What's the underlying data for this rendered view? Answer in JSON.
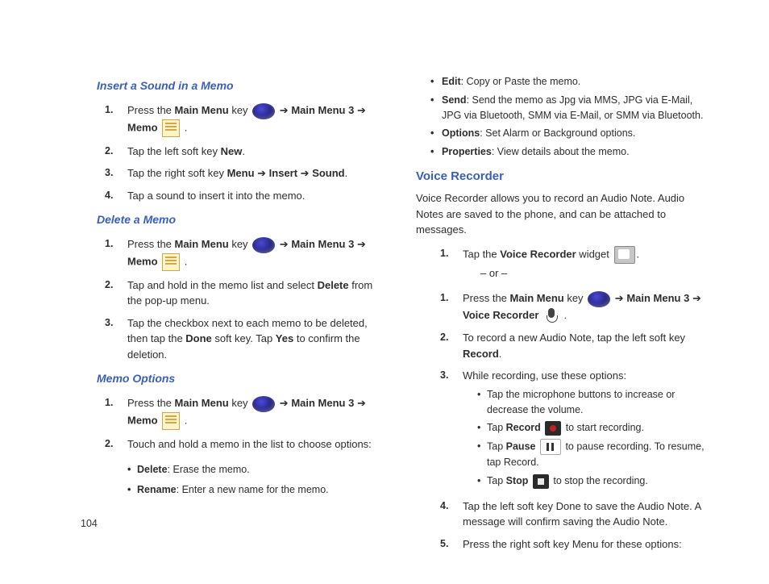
{
  "pageNumber": "104",
  "sec1": {
    "title": "Insert a Sound in a Memo",
    "s1a": "Press the ",
    "s1b": "Main Menu",
    "s1c": " key ",
    "s1d": " ➔ ",
    "s1e": "Main Menu 3",
    "s1f": " ➔ ",
    "s1g": "Memo",
    "s1h": " .",
    "s2a": "Tap the left soft key ",
    "s2b": "New",
    "s2c": ".",
    "s3a": "Tap the right soft key ",
    "s3b": "Menu",
    "s3c": " ➔ ",
    "s3d": "Insert",
    "s3e": " ➔ ",
    "s3f": "Sound",
    "s3g": ".",
    "s4": "Tap a sound to insert it into the memo."
  },
  "sec2": {
    "title": "Delete a Memo",
    "s1a": "Press the ",
    "s1b": "Main Menu",
    "s1c": " key ",
    "s1d": " ➔ ",
    "s1e": "Main Menu 3",
    "s1f": " ➔ ",
    "s1g": "Memo",
    "s1h": " .",
    "s2a": "Tap and hold in the memo list and select ",
    "s2b": "Delete",
    "s2c": " from the pop-up menu.",
    "s3a": "Tap the checkbox next to each memo to be deleted, then tap the ",
    "s3b": "Done",
    "s3c": " soft key.  Tap ",
    "s3d": "Yes",
    "s3e": " to confirm the deletion."
  },
  "sec3": {
    "title": "Memo Options",
    "s1a": "Press the ",
    "s1b": "Main Menu",
    "s1c": " key ",
    "s1d": " ➔ ",
    "s1e": "Main Menu 3",
    "s1f": " ➔ ",
    "s1g": "Memo",
    "s1h": " .",
    "s2": "Touch and hold a memo in the list to choose options:",
    "b1a": "Delete",
    "b1b": ": Erase the memo.",
    "b2a": "Rename",
    "b2b": ": Enter a new name for the memo."
  },
  "right": {
    "b1a": "Edit",
    "b1b": ": Copy or Paste the memo.",
    "b2a": "Send",
    "b2b": ": Send the memo as Jpg via MMS, JPG via E-Mail, JPG via Bluetooth, SMM via E-Mail, or SMM via Bluetooth.",
    "b3a": "Options",
    "b3b": ": Set Alarm or Background options.",
    "b4a": "Properties",
    "b4b": ": View details about the memo."
  },
  "sec4": {
    "title": "Voice Recorder",
    "intro": "Voice Recorder allows you to record an Audio Note.  Audio Notes are saved to the phone, and can be attached to messages.",
    "s1a": "Tap the ",
    "s1b": "Voice Recorder",
    "s1c": " widget ",
    "or": "– or –",
    "s1d": "Press the ",
    "s1e": "Main Menu",
    "s1f": " key ",
    "s1g": " ➔ ",
    "s1h": "Main Menu 3",
    "s1i": " ➔ ",
    "s1j": "Voice Recorder",
    "s1k": " .",
    "s2a": "To record a new Audio Note, tap the left soft key ",
    "s2b": "Record",
    "s2c": ".",
    "s3": "While recording, use these options:",
    "sb1": "Tap the microphone buttons to increase or decrease the volume.",
    "sb2a": "Tap ",
    "sb2b": "Record",
    "sb2c": " to start recording.",
    "sb3a": "Tap ",
    "sb3b": "Pause",
    "sb3c": " to pause recording. To resume, tap Record.",
    "sb4a": "Tap ",
    "sb4b": "Stop",
    "sb4c": " to stop the recording.",
    "s4": "Tap the left soft key Done to save the Audio Note. A message will confirm saving the Audio Note.",
    "s5": "Press the right soft key Menu for these options:"
  }
}
